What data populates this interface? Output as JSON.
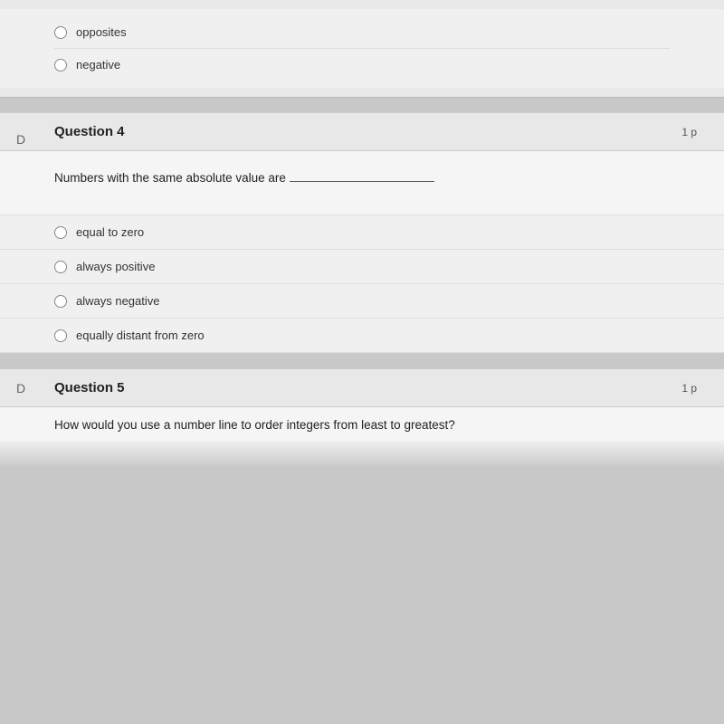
{
  "prev_question": {
    "options": [
      {
        "label": "opposites",
        "id": "opt-opposites"
      },
      {
        "label": "negative",
        "id": "opt-negative"
      }
    ]
  },
  "question4": {
    "title": "Question 4",
    "points": "1 p",
    "letter": "D",
    "question_text": "Numbers with the same absolute value are",
    "blank": "___________________________.",
    "options": [
      {
        "id": "q4-opt1",
        "label": "equal to zero"
      },
      {
        "id": "q4-opt2",
        "label": "always positive"
      },
      {
        "id": "q4-opt3",
        "label": "always negative"
      },
      {
        "id": "q4-opt4",
        "label": "equally distant from zero"
      }
    ]
  },
  "question5": {
    "title": "Question 5",
    "points": "1 p",
    "letter": "D",
    "question_text": "How would you use a number line to order integers from least to greatest?"
  }
}
